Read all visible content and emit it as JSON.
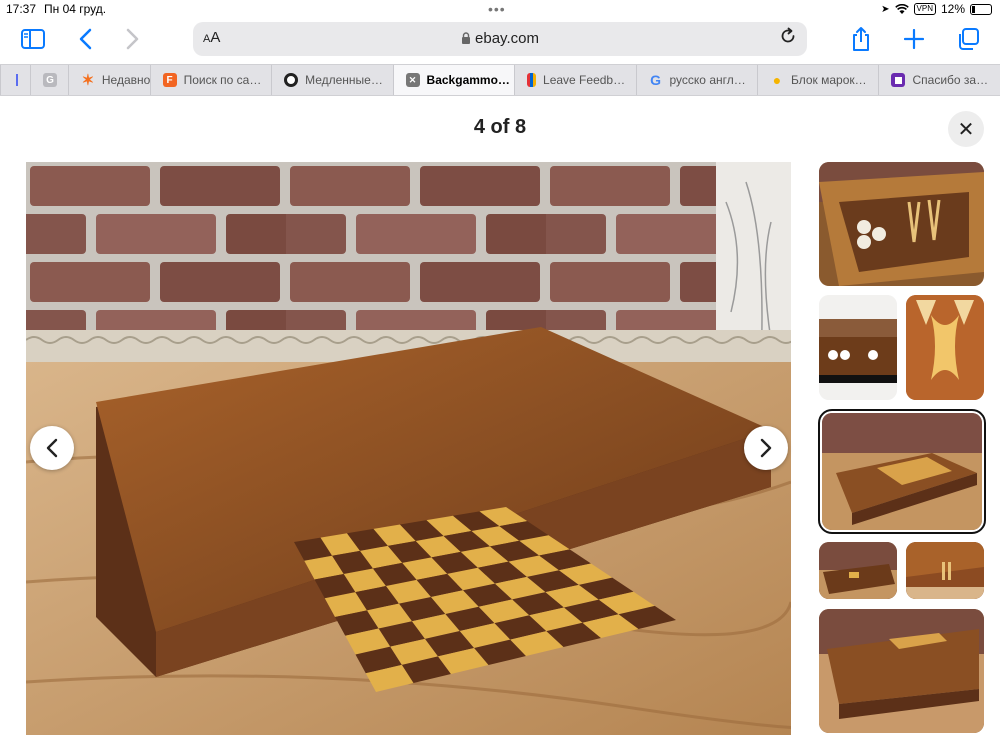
{
  "status": {
    "time": "17:37",
    "date": "Пн 04 груд.",
    "vpn": "VPN",
    "battery": "12%"
  },
  "toolbar": {
    "text_size": "AA",
    "url": "ebay.com"
  },
  "tabs": [
    {
      "label": "",
      "icon": "tab-generic-icon",
      "color": "#5b6df0"
    },
    {
      "label": "",
      "icon": "google-g-gray-icon",
      "color": "#b9b9be"
    },
    {
      "label": "Недавно",
      "icon": "asterisk-orange-icon",
      "color": "#f4701f"
    },
    {
      "label": "Поиск по са…",
      "icon": "f-orange-square-icon",
      "color": "#f26522"
    },
    {
      "label": "Медленные…",
      "icon": "avatar-face-icon",
      "color": "#333333"
    },
    {
      "label": "Backgammo…",
      "icon": "close-icon",
      "color": "#555555",
      "active": true
    },
    {
      "label": "Leave Feedb…",
      "icon": "shopping-bag-icon",
      "color": "#e53238"
    },
    {
      "label": "русско англ…",
      "icon": "google-icon",
      "color": "#4285f4"
    },
    {
      "label": "Блок марок…",
      "icon": "map-pin-icon",
      "color": "#f5b400"
    },
    {
      "label": "Спасибо за…",
      "icon": "purple-square-icon",
      "color": "#6a2bb0"
    }
  ],
  "viewer": {
    "counter": "4 of 8",
    "current": 4,
    "total": 8
  },
  "colors": {
    "accent": "#0a7aff",
    "wood": "#8a4f23",
    "board_light": "#e2b04a",
    "board_dark": "#5c3018"
  },
  "thumbnails": [
    {
      "name": "backgammon-open-board",
      "selected": false
    },
    {
      "name": "backgammon-pieces-side",
      "selected": false
    },
    {
      "name": "board-inlay-ornament",
      "selected": false
    },
    {
      "name": "closed-board-chess-top",
      "selected": true
    },
    {
      "name": "closed-board-dark",
      "selected": false
    },
    {
      "name": "closed-board-hinges",
      "selected": false
    },
    {
      "name": "closed-board-edge",
      "selected": false
    }
  ]
}
